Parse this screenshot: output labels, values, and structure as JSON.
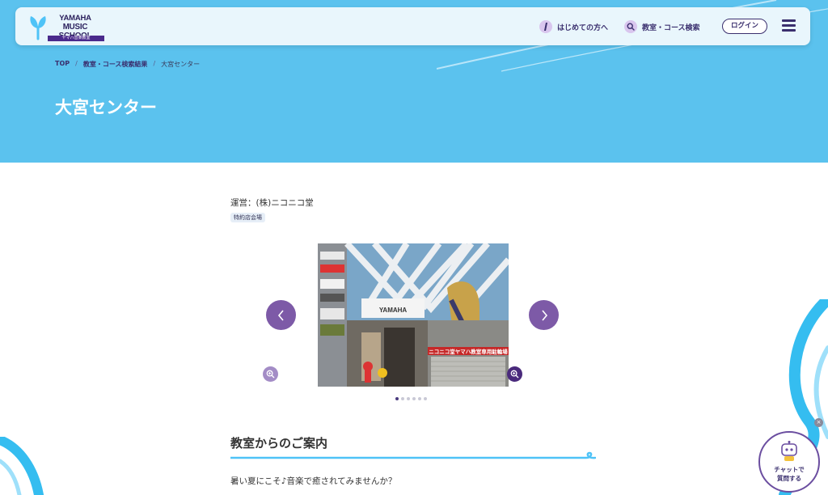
{
  "header": {
    "logo": {
      "line1": "YAMAHA",
      "line2": "MUSIC SCHOOL",
      "sub": "ヤマハ音楽教室"
    },
    "nav": [
      {
        "label": "はじめての方へ",
        "icon": "beginner-icon"
      },
      {
        "label": "教室・コース検索",
        "icon": "search-icon"
      }
    ],
    "login_label": "ログイン",
    "menu_icon": "hamburger-menu-icon"
  },
  "breadcrumb": {
    "items": [
      "TOP",
      "教室・コース検索結果",
      "大宮センター"
    ],
    "separator": "/"
  },
  "page_title": "大宮センター",
  "content": {
    "operator": "運営：(株)ニコニコ堂",
    "badge": "特約店会場",
    "carousel": {
      "slide_count": 6,
      "active_index": 0,
      "store_sign": "YAMAHA",
      "banner_text": "ニコニコ堂ヤマハ教室専用駐輪場"
    },
    "section_title": "教室からのご案内",
    "body_text": "暑い夏にこそ♪音楽で癒されてみませんか？"
  },
  "chat": {
    "line1": "チャットで",
    "line2": "質問する",
    "close": "×"
  },
  "colors": {
    "hero_bg": "#5bc2ee",
    "accent_purple": "#7d5aa7",
    "dark_purple": "#3a2f6e",
    "light_blue": "#4fc3f7"
  }
}
